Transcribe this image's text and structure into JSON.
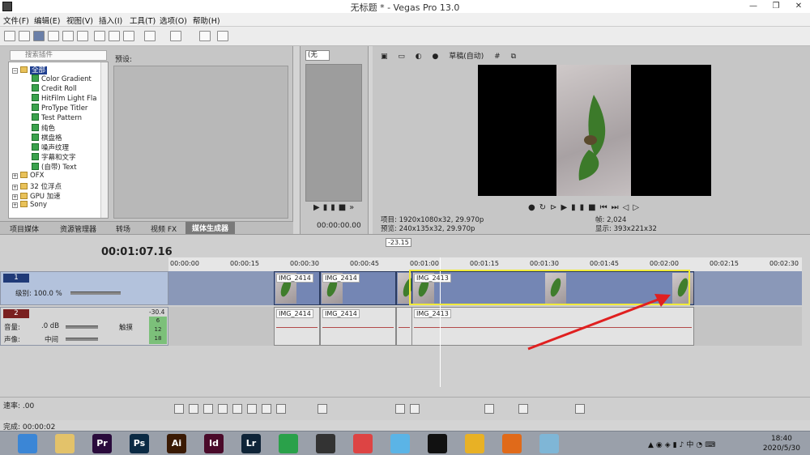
{
  "window": {
    "title": "无标题 * - Vegas Pro 13.0"
  },
  "menu": [
    "文件(F)",
    "编辑(E)",
    "视图(V)",
    "插入(I)",
    "工具(T)",
    "选项(O)",
    "帮助(H)"
  ],
  "plugins": {
    "search_placeholder": "搜索插件",
    "presets_label": "预设:",
    "tree": [
      {
        "label": "全部",
        "type": "folder",
        "selected": true
      },
      {
        "label": "Color Gradient",
        "type": "generator"
      },
      {
        "label": "Credit Roll",
        "type": "generator"
      },
      {
        "label": "HitFilm Light Fla",
        "type": "generator"
      },
      {
        "label": "ProType Titler",
        "type": "generator"
      },
      {
        "label": "Test Pattern",
        "type": "generator"
      },
      {
        "label": "纯色",
        "type": "generator"
      },
      {
        "label": "棋盘格",
        "type": "generator"
      },
      {
        "label": "噪声纹理",
        "type": "generator"
      },
      {
        "label": "字幕和文字",
        "type": "generator"
      },
      {
        "label": "(自带) Text",
        "type": "generator"
      },
      {
        "label": "OFX",
        "type": "folder"
      },
      {
        "label": "32 位浮点",
        "type": "folder"
      },
      {
        "label": "GPU 加速",
        "type": "folder"
      },
      {
        "label": "Sony",
        "type": "folder"
      }
    ],
    "tabs": [
      "项目媒体",
      "资源管理器",
      "转场",
      "视频 FX",
      "媒体生成器"
    ],
    "active_tab": "媒体生成器"
  },
  "trimmer": {
    "select_value": "(无",
    "time": "00:00:00.00"
  },
  "preview": {
    "quality": "草稿(自动)",
    "project_line": "项目: 1920x1080x32, 29.970p",
    "preview_line": "预览: 240x135x32, 29.970p",
    "frame_line": "帧:      2,024",
    "display_line": "显示: 393x221x32"
  },
  "timeline": {
    "current_time": "00:01:07.16",
    "marker": "-23.15",
    "ruler": [
      "00:00:00",
      "00:00:15",
      "00:00:30",
      "00:00:45",
      "00:01:00",
      "00:01:15",
      "00:01:30",
      "00:01:45",
      "00:02:00",
      "00:02:15",
      "00:02:30"
    ],
    "video_track": {
      "number": "1",
      "level": "级别: 100.0 %"
    },
    "audio_track": {
      "number": "2",
      "volume": "音量:",
      "volume_value": ".0 dB",
      "pan": "声像:",
      "pan_value": "中间",
      "touch": "触摸",
      "meter_top": "-30.4",
      "meter_vals": [
        "6",
        "12",
        "18"
      ]
    },
    "clips": [
      {
        "label": "IMG_2414",
        "start_pct": 0.166,
        "width_pct": 0.073
      },
      {
        "label": "IMG_2414",
        "start_pct": 0.239,
        "width_pct": 0.12
      },
      {
        "label": "",
        "start_pct": 0.359,
        "width_pct": 0.025
      },
      {
        "label": "IMG_2413",
        "start_pct": 0.384,
        "width_pct": 0.446
      }
    ]
  },
  "bottom": {
    "rate": "速率: .00",
    "status": "完成: 00:00:02"
  },
  "taskbar": {
    "apps": [
      {
        "name": "ie",
        "label": "",
        "color": "#3b86d6"
      },
      {
        "name": "explorer",
        "label": "",
        "color": "#e3c26a"
      },
      {
        "name": "premiere",
        "label": "Pr",
        "color": "#2a0b3c"
      },
      {
        "name": "photoshop",
        "label": "Ps",
        "color": "#0b2a44"
      },
      {
        "name": "illustrator",
        "label": "Ai",
        "color": "#3a1a04"
      },
      {
        "name": "indesign",
        "label": "Id",
        "color": "#4a0a2a"
      },
      {
        "name": "lightroom",
        "label": "Lr",
        "color": "#0f2438"
      },
      {
        "name": "app-green",
        "label": "",
        "color": "#2aa14a"
      },
      {
        "name": "vegas",
        "label": "",
        "color": "#333"
      },
      {
        "name": "app-colors",
        "label": "",
        "color": "#d44"
      },
      {
        "name": "app-blue",
        "label": "",
        "color": "#5bb4e6"
      },
      {
        "name": "qq",
        "label": "",
        "color": "#111"
      },
      {
        "name": "chrome",
        "label": "",
        "color": "#e8b125"
      },
      {
        "name": "firefox",
        "label": "",
        "color": "#e06a1a"
      },
      {
        "name": "app-note",
        "label": "",
        "color": "#7fb6d6"
      }
    ],
    "time": "18:40",
    "date": "2020/5/30"
  }
}
